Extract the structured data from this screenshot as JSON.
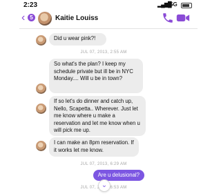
{
  "status_bar": {
    "time": "2:23",
    "network": "5G"
  },
  "header": {
    "unread_count": "5",
    "contact_name": "Kaitie Louiss"
  },
  "messages": [
    {
      "text": "Did u wear pink?!"
    },
    {
      "text": "So what's the plan? I keep my schedule private but ill be in NYC Monday.... Will u be in town?"
    },
    {
      "text": "If so let's do dinner and catch up, Nello, Scapetta.. Wherever. Just let me know where u make a reservation and let me know when u will pick me up."
    },
    {
      "text": "I can make an 8pm reservation. If it works let me know."
    }
  ],
  "timestamps": [
    "JUL 07, 2013, 2:55 AM",
    "JUL 07, 2013, 6:29 AM",
    "JUL 07, 2013, 6:53 AM"
  ],
  "sent_message": {
    "text": "Are u delusional?"
  },
  "colors": {
    "accent": "#8a4bd6",
    "sent_bubble": "#7c56e2",
    "received_bubble": "#ececec"
  },
  "icons": [
    "chevron-left-icon",
    "phone-icon",
    "video-camera-icon",
    "chevron-down-icon"
  ]
}
